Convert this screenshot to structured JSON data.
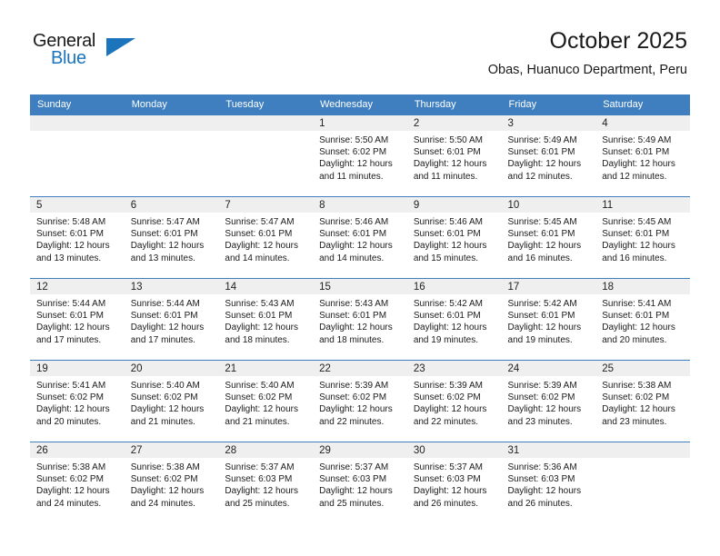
{
  "logo": {
    "primary_text": "General",
    "secondary_text": "Blue",
    "accent_color": "#1c75bc"
  },
  "header": {
    "title": "October 2025",
    "subtitle": "Obas, Huanuco Department, Peru"
  },
  "theme": {
    "header_bar_color": "#3f7fbf",
    "daynum_band_color": "#efefef",
    "text_color": "#1a1a1a"
  },
  "weekday_headers": [
    "Sunday",
    "Monday",
    "Tuesday",
    "Wednesday",
    "Thursday",
    "Friday",
    "Saturday"
  ],
  "weeks": [
    [
      {
        "day": "",
        "empty": true,
        "sunrise": "",
        "sunset": "",
        "daylight_line1": "",
        "daylight_line2": ""
      },
      {
        "day": "",
        "empty": true,
        "sunrise": "",
        "sunset": "",
        "daylight_line1": "",
        "daylight_line2": ""
      },
      {
        "day": "",
        "empty": true,
        "sunrise": "",
        "sunset": "",
        "daylight_line1": "",
        "daylight_line2": ""
      },
      {
        "day": "1",
        "empty": false,
        "sunrise": "Sunrise: 5:50 AM",
        "sunset": "Sunset: 6:02 PM",
        "daylight_line1": "Daylight: 12 hours",
        "daylight_line2": "and 11 minutes."
      },
      {
        "day": "2",
        "empty": false,
        "sunrise": "Sunrise: 5:50 AM",
        "sunset": "Sunset: 6:01 PM",
        "daylight_line1": "Daylight: 12 hours",
        "daylight_line2": "and 11 minutes."
      },
      {
        "day": "3",
        "empty": false,
        "sunrise": "Sunrise: 5:49 AM",
        "sunset": "Sunset: 6:01 PM",
        "daylight_line1": "Daylight: 12 hours",
        "daylight_line2": "and 12 minutes."
      },
      {
        "day": "4",
        "empty": false,
        "sunrise": "Sunrise: 5:49 AM",
        "sunset": "Sunset: 6:01 PM",
        "daylight_line1": "Daylight: 12 hours",
        "daylight_line2": "and 12 minutes."
      }
    ],
    [
      {
        "day": "5",
        "empty": false,
        "sunrise": "Sunrise: 5:48 AM",
        "sunset": "Sunset: 6:01 PM",
        "daylight_line1": "Daylight: 12 hours",
        "daylight_line2": "and 13 minutes."
      },
      {
        "day": "6",
        "empty": false,
        "sunrise": "Sunrise: 5:47 AM",
        "sunset": "Sunset: 6:01 PM",
        "daylight_line1": "Daylight: 12 hours",
        "daylight_line2": "and 13 minutes."
      },
      {
        "day": "7",
        "empty": false,
        "sunrise": "Sunrise: 5:47 AM",
        "sunset": "Sunset: 6:01 PM",
        "daylight_line1": "Daylight: 12 hours",
        "daylight_line2": "and 14 minutes."
      },
      {
        "day": "8",
        "empty": false,
        "sunrise": "Sunrise: 5:46 AM",
        "sunset": "Sunset: 6:01 PM",
        "daylight_line1": "Daylight: 12 hours",
        "daylight_line2": "and 14 minutes."
      },
      {
        "day": "9",
        "empty": false,
        "sunrise": "Sunrise: 5:46 AM",
        "sunset": "Sunset: 6:01 PM",
        "daylight_line1": "Daylight: 12 hours",
        "daylight_line2": "and 15 minutes."
      },
      {
        "day": "10",
        "empty": false,
        "sunrise": "Sunrise: 5:45 AM",
        "sunset": "Sunset: 6:01 PM",
        "daylight_line1": "Daylight: 12 hours",
        "daylight_line2": "and 16 minutes."
      },
      {
        "day": "11",
        "empty": false,
        "sunrise": "Sunrise: 5:45 AM",
        "sunset": "Sunset: 6:01 PM",
        "daylight_line1": "Daylight: 12 hours",
        "daylight_line2": "and 16 minutes."
      }
    ],
    [
      {
        "day": "12",
        "empty": false,
        "sunrise": "Sunrise: 5:44 AM",
        "sunset": "Sunset: 6:01 PM",
        "daylight_line1": "Daylight: 12 hours",
        "daylight_line2": "and 17 minutes."
      },
      {
        "day": "13",
        "empty": false,
        "sunrise": "Sunrise: 5:44 AM",
        "sunset": "Sunset: 6:01 PM",
        "daylight_line1": "Daylight: 12 hours",
        "daylight_line2": "and 17 minutes."
      },
      {
        "day": "14",
        "empty": false,
        "sunrise": "Sunrise: 5:43 AM",
        "sunset": "Sunset: 6:01 PM",
        "daylight_line1": "Daylight: 12 hours",
        "daylight_line2": "and 18 minutes."
      },
      {
        "day": "15",
        "empty": false,
        "sunrise": "Sunrise: 5:43 AM",
        "sunset": "Sunset: 6:01 PM",
        "daylight_line1": "Daylight: 12 hours",
        "daylight_line2": "and 18 minutes."
      },
      {
        "day": "16",
        "empty": false,
        "sunrise": "Sunrise: 5:42 AM",
        "sunset": "Sunset: 6:01 PM",
        "daylight_line1": "Daylight: 12 hours",
        "daylight_line2": "and 19 minutes."
      },
      {
        "day": "17",
        "empty": false,
        "sunrise": "Sunrise: 5:42 AM",
        "sunset": "Sunset: 6:01 PM",
        "daylight_line1": "Daylight: 12 hours",
        "daylight_line2": "and 19 minutes."
      },
      {
        "day": "18",
        "empty": false,
        "sunrise": "Sunrise: 5:41 AM",
        "sunset": "Sunset: 6:01 PM",
        "daylight_line1": "Daylight: 12 hours",
        "daylight_line2": "and 20 minutes."
      }
    ],
    [
      {
        "day": "19",
        "empty": false,
        "sunrise": "Sunrise: 5:41 AM",
        "sunset": "Sunset: 6:02 PM",
        "daylight_line1": "Daylight: 12 hours",
        "daylight_line2": "and 20 minutes."
      },
      {
        "day": "20",
        "empty": false,
        "sunrise": "Sunrise: 5:40 AM",
        "sunset": "Sunset: 6:02 PM",
        "daylight_line1": "Daylight: 12 hours",
        "daylight_line2": "and 21 minutes."
      },
      {
        "day": "21",
        "empty": false,
        "sunrise": "Sunrise: 5:40 AM",
        "sunset": "Sunset: 6:02 PM",
        "daylight_line1": "Daylight: 12 hours",
        "daylight_line2": "and 21 minutes."
      },
      {
        "day": "22",
        "empty": false,
        "sunrise": "Sunrise: 5:39 AM",
        "sunset": "Sunset: 6:02 PM",
        "daylight_line1": "Daylight: 12 hours",
        "daylight_line2": "and 22 minutes."
      },
      {
        "day": "23",
        "empty": false,
        "sunrise": "Sunrise: 5:39 AM",
        "sunset": "Sunset: 6:02 PM",
        "daylight_line1": "Daylight: 12 hours",
        "daylight_line2": "and 22 minutes."
      },
      {
        "day": "24",
        "empty": false,
        "sunrise": "Sunrise: 5:39 AM",
        "sunset": "Sunset: 6:02 PM",
        "daylight_line1": "Daylight: 12 hours",
        "daylight_line2": "and 23 minutes."
      },
      {
        "day": "25",
        "empty": false,
        "sunrise": "Sunrise: 5:38 AM",
        "sunset": "Sunset: 6:02 PM",
        "daylight_line1": "Daylight: 12 hours",
        "daylight_line2": "and 23 minutes."
      }
    ],
    [
      {
        "day": "26",
        "empty": false,
        "sunrise": "Sunrise: 5:38 AM",
        "sunset": "Sunset: 6:02 PM",
        "daylight_line1": "Daylight: 12 hours",
        "daylight_line2": "and 24 minutes."
      },
      {
        "day": "27",
        "empty": false,
        "sunrise": "Sunrise: 5:38 AM",
        "sunset": "Sunset: 6:02 PM",
        "daylight_line1": "Daylight: 12 hours",
        "daylight_line2": "and 24 minutes."
      },
      {
        "day": "28",
        "empty": false,
        "sunrise": "Sunrise: 5:37 AM",
        "sunset": "Sunset: 6:03 PM",
        "daylight_line1": "Daylight: 12 hours",
        "daylight_line2": "and 25 minutes."
      },
      {
        "day": "29",
        "empty": false,
        "sunrise": "Sunrise: 5:37 AM",
        "sunset": "Sunset: 6:03 PM",
        "daylight_line1": "Daylight: 12 hours",
        "daylight_line2": "and 25 minutes."
      },
      {
        "day": "30",
        "empty": false,
        "sunrise": "Sunrise: 5:37 AM",
        "sunset": "Sunset: 6:03 PM",
        "daylight_line1": "Daylight: 12 hours",
        "daylight_line2": "and 26 minutes."
      },
      {
        "day": "31",
        "empty": false,
        "sunrise": "Sunrise: 5:36 AM",
        "sunset": "Sunset: 6:03 PM",
        "daylight_line1": "Daylight: 12 hours",
        "daylight_line2": "and 26 minutes."
      },
      {
        "day": "",
        "empty": true,
        "sunrise": "",
        "sunset": "",
        "daylight_line1": "",
        "daylight_line2": ""
      }
    ]
  ]
}
